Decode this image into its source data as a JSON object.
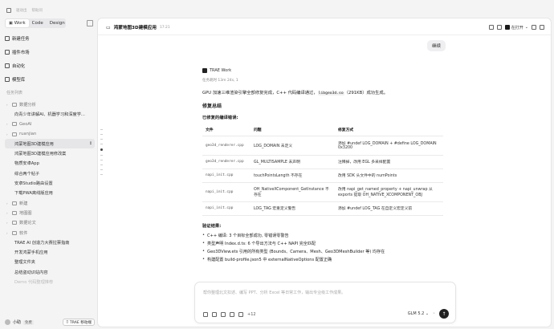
{
  "topbar": {
    "item1": "驱动出",
    "item2": "帮助问"
  },
  "tabs": [
    {
      "label": "Work"
    },
    {
      "label": "Code"
    },
    {
      "label": "Design"
    }
  ],
  "nav": [
    {
      "label": "新建任务"
    },
    {
      "label": "插件市场"
    },
    {
      "label": "自动化"
    },
    {
      "label": "模型库"
    }
  ],
  "tasks_section": "任务列表",
  "tree": [
    {
      "label": "数据分析",
      "type": "grp"
    },
    {
      "label": "向青少年讲解AI、机器学习和深度学...",
      "type": "sub"
    },
    {
      "label": "GeoAI",
      "type": "grp"
    },
    {
      "label": "ruanjian",
      "type": "grp"
    },
    {
      "label": "鸿蒙地图3D建模应用",
      "type": "sub sel",
      "pin": "↕"
    },
    {
      "label": "鸿蒙地图3D建模应用修改案",
      "type": "sub"
    },
    {
      "label": "物质安卓App",
      "type": "sub"
    },
    {
      "label": "综合两个帖子",
      "type": "sub"
    },
    {
      "label": "安卓Studio路由设置",
      "type": "sub"
    },
    {
      "label": "下载PWA离线版应用",
      "type": "sub"
    },
    {
      "label": "新建",
      "type": "grp"
    },
    {
      "label": "地图图",
      "type": "grp"
    },
    {
      "label": "数据论文",
      "type": "grp"
    },
    {
      "label": "软件",
      "type": "grp"
    },
    {
      "label": "TRAE AI 创造力大赛拉票指南",
      "type": "sub"
    },
    {
      "label": "开发鸿蒙手机应用",
      "type": "sub"
    },
    {
      "label": "整理文件夹",
      "type": "sub"
    },
    {
      "label": "总结盗动识站内容",
      "type": "sub"
    },
    {
      "label": "Demo 代码整理推荐",
      "type": "sub fade"
    }
  ],
  "user": {
    "name": "小助",
    "plan": "免费",
    "mode": "TRAE 移动端"
  },
  "header": {
    "title": "鸿蒙地图3D建模应用",
    "time": "17:21",
    "open_label": "在打开"
  },
  "bubble": "继续",
  "agent": {
    "name": "TRAE Work",
    "meta": "任务耗时 13m 24s, 1"
  },
  "summary_p": [
    "GPU 加速三维渲染引擎全部修复完成，C++ 代码编译通过，",
    "libgeo3d.so",
    "（291KB）成功生成。"
  ],
  "fix_summary": "修复总结",
  "fixed_errors": "已修复的编译错误:",
  "table": {
    "headers": [
      "文件",
      "问题",
      "修复方式"
    ],
    "rows": [
      [
        "geo3d_renderer.cpp",
        "LOG_DOMAIN 未定义",
        "添加 #undef LOG_DOMAIN + #define LOG_DOMAIN 0x3200"
      ],
      [
        "geo3d_renderer.cpp",
        "GL_MULTISAMPLE 未声明",
        "注释掉，改用 EGL 多采样配置"
      ],
      [
        "napi_init.cpp",
        "touchPointsLength 不存在",
        "改用 SDK 头文件中的 numPoints"
      ],
      [
        "napi_init.cpp",
        "OH_NativeXComponent_GetInstance 不存在",
        "改用 napi_get_named_property + napi_unwrap 从 exports 提取 OH_NATIVE_XCOMPONENT_OBJ"
      ],
      [
        "napi_init.cpp",
        "LOG_TAG 宏重定义警告",
        "添加 #undef LOG_TAG 在自定义宏定义前"
      ]
    ]
  },
  "verify": "验证结果:",
  "bullets": [
    "C++ 编译: 3 个目标全部成功, 零错误零警告",
    "类型声明 Index.d.ts: 6 个导出方法与 C++ NAPI 完全匹配",
    "Geo3DView.ets 引用的所有类型 (Bounds、Camera、Mesh、Geo3DMeshBuilder 等) 均存在",
    "构建配置 build-profile.json5 中 externalNativeOptions 配置正确"
  ],
  "composer": {
    "placeholder": "帮你整理北文扣述、编写 PPT、分析 Excel 等日常工作，输出专业级工作成果。",
    "plus_count": "+12",
    "model": "GLM 5.2"
  }
}
